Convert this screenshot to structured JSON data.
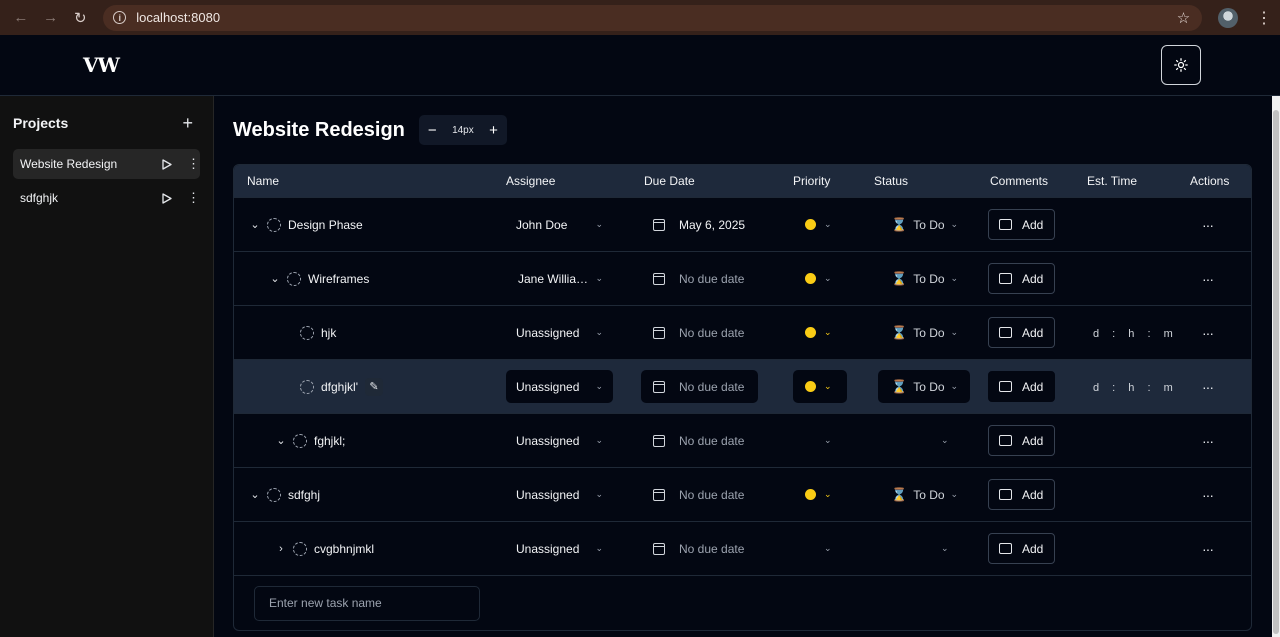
{
  "browser": {
    "url": "localhost:8080"
  },
  "app": {
    "logo": "VW"
  },
  "sidebar": {
    "title": "Projects",
    "projects": [
      {
        "label": "Website Redesign",
        "active": true
      },
      {
        "label": "sdfghjk",
        "active": false
      }
    ]
  },
  "main": {
    "title": "Website Redesign",
    "zoom": "14px",
    "columns": [
      "Name",
      "Assignee",
      "Due Date",
      "Priority",
      "Status",
      "Comments",
      "Est. Time",
      "Actions"
    ],
    "rows": [
      {
        "name": "Design Phase",
        "assignee": "John Doe",
        "due": "May 6, 2025",
        "priority": "yellow",
        "status": "To Do",
        "comment": "Add",
        "est": ""
      },
      {
        "name": "Wireframes",
        "assignee": "Jane Willia…",
        "due": "No due date",
        "priority": "yellow",
        "status": "To Do",
        "comment": "Add",
        "est": ""
      },
      {
        "name": "hjk",
        "assignee": "Unassigned",
        "due": "No due date",
        "priority": "yellow",
        "status": "To Do",
        "comment": "Add",
        "est": "d : h : m"
      },
      {
        "name": "dfghjkl'",
        "assignee": "Unassigned",
        "due": "No due date",
        "priority": "yellow",
        "status": "To Do",
        "comment": "Add",
        "est": "d : h : m"
      },
      {
        "name": "fghjkl;",
        "assignee": "Unassigned",
        "due": "No due date",
        "priority": "",
        "status": "",
        "comment": "Add",
        "est": ""
      },
      {
        "name": "sdfghj",
        "assignee": "Unassigned",
        "due": "No due date",
        "priority": "yellow",
        "status": "To Do",
        "comment": "Add",
        "est": ""
      },
      {
        "name": "cvgbhnjmkl",
        "assignee": "Unassigned",
        "due": "No due date",
        "priority": "",
        "status": "",
        "comment": "Add",
        "est": ""
      }
    ],
    "new_task_placeholder": "Enter new task name"
  },
  "colors": {
    "priority_yellow": "#facc15",
    "accent_row": "#1e293b",
    "background": "#030712"
  }
}
